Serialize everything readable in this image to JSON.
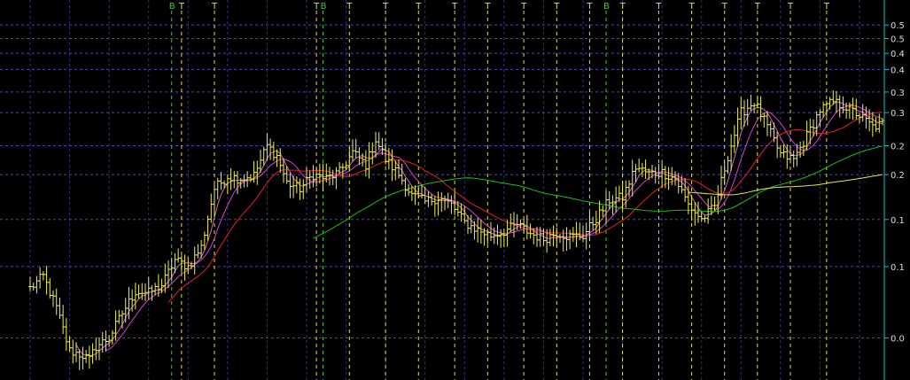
{
  "chart_data": {
    "type": "line",
    "y_scale": "log",
    "ylim": [
      0.065,
      0.56
    ],
    "x_count": 260,
    "y_ticks": [
      "0.5",
      "0.5",
      "0.4",
      "0.4",
      "0.3",
      "0.3",
      "0.2",
      "0.2",
      "0.1",
      "0.1",
      "0.0"
    ],
    "y_tick_values": [
      0.52,
      0.48,
      0.44,
      0.4,
      0.35,
      0.31,
      0.255,
      0.215,
      0.165,
      0.125,
      0.082
    ],
    "grid": true,
    "markers": [
      {
        "label": "B",
        "x": 43,
        "color": "#33cc33"
      },
      {
        "label": "T",
        "x": 46,
        "color": "#e0e040"
      },
      {
        "label": "T",
        "x": 56,
        "color": "#e0e040"
      },
      {
        "label": "T",
        "x": 87,
        "color": "#e0e040"
      },
      {
        "label": "B",
        "x": 89,
        "color": "#33cc33"
      },
      {
        "label": "T",
        "x": 97,
        "color": "#e0e040"
      },
      {
        "label": "T",
        "x": 108,
        "color": "#e0e040"
      },
      {
        "label": "T",
        "x": 118,
        "color": "#e0e040"
      },
      {
        "label": "T",
        "x": 129,
        "color": "#e0e040"
      },
      {
        "label": "T",
        "x": 139,
        "color": "#e0e040"
      },
      {
        "label": "T",
        "x": 150,
        "color": "#e0e040"
      },
      {
        "label": "T",
        "x": 160,
        "color": "#e0e040"
      },
      {
        "label": "T",
        "x": 170,
        "color": "#e0e040"
      },
      {
        "label": "B",
        "x": 175,
        "color": "#33cc33"
      },
      {
        "label": "T",
        "x": 180,
        "color": "#e0e040"
      },
      {
        "label": "T",
        "x": 191,
        "color": "#e0e040"
      },
      {
        "label": "T",
        "x": 201,
        "color": "#e0e040"
      },
      {
        "label": "T",
        "x": 211,
        "color": "#e0e040"
      },
      {
        "label": "T",
        "x": 221,
        "color": "#e0e040"
      },
      {
        "label": "T",
        "x": 231,
        "color": "#e0e040"
      },
      {
        "label": "T",
        "x": 242,
        "color": "#e0e040"
      }
    ],
    "price_anchors": [
      [
        0,
        0.11
      ],
      [
        4,
        0.118
      ],
      [
        8,
        0.098
      ],
      [
        12,
        0.076
      ],
      [
        16,
        0.074
      ],
      [
        18,
        0.072
      ],
      [
        20,
        0.078
      ],
      [
        24,
        0.082
      ],
      [
        28,
        0.095
      ],
      [
        32,
        0.108
      ],
      [
        36,
        0.107
      ],
      [
        40,
        0.112
      ],
      [
        44,
        0.13
      ],
      [
        48,
        0.125
      ],
      [
        52,
        0.14
      ],
      [
        56,
        0.198
      ],
      [
        60,
        0.213
      ],
      [
        64,
        0.21
      ],
      [
        68,
        0.214
      ],
      [
        72,
        0.255
      ],
      [
        75,
        0.24
      ],
      [
        78,
        0.205
      ],
      [
        82,
        0.198
      ],
      [
        86,
        0.215
      ],
      [
        90,
        0.21
      ],
      [
        94,
        0.218
      ],
      [
        98,
        0.245
      ],
      [
        102,
        0.228
      ],
      [
        105,
        0.265
      ],
      [
        108,
        0.235
      ],
      [
        112,
        0.215
      ],
      [
        116,
        0.19
      ],
      [
        120,
        0.183
      ],
      [
        124,
        0.188
      ],
      [
        128,
        0.18
      ],
      [
        132,
        0.162
      ],
      [
        136,
        0.155
      ],
      [
        140,
        0.15
      ],
      [
        144,
        0.154
      ],
      [
        148,
        0.16
      ],
      [
        152,
        0.152
      ],
      [
        156,
        0.147
      ],
      [
        160,
        0.153
      ],
      [
        164,
        0.149
      ],
      [
        168,
        0.15
      ],
      [
        172,
        0.166
      ],
      [
        176,
        0.185
      ],
      [
        180,
        0.188
      ],
      [
        184,
        0.225
      ],
      [
        188,
        0.216
      ],
      [
        192,
        0.218
      ],
      [
        196,
        0.21
      ],
      [
        200,
        0.18
      ],
      [
        204,
        0.165
      ],
      [
        208,
        0.178
      ],
      [
        212,
        0.24
      ],
      [
        216,
        0.31
      ],
      [
        220,
        0.33
      ],
      [
        224,
        0.285
      ],
      [
        228,
        0.242
      ],
      [
        232,
        0.235
      ],
      [
        236,
        0.27
      ],
      [
        240,
        0.315
      ],
      [
        244,
        0.33
      ],
      [
        248,
        0.32
      ],
      [
        252,
        0.305
      ],
      [
        256,
        0.285
      ],
      [
        259,
        0.29
      ]
    ],
    "series": [
      {
        "period": 5,
        "start": 14,
        "color": "#cc66cc"
      },
      {
        "period": 10,
        "start": 23,
        "color": "#d040d0"
      },
      {
        "period": 21,
        "start": 42,
        "color": "#e02020"
      },
      {
        "period": 80,
        "start": 86,
        "color": "#10c010"
      },
      {
        "period": 140,
        "start": 200,
        "color": "#e8e840"
      }
    ],
    "colors": {
      "background": "#000000",
      "grid": "#4a4aa0",
      "price_bars": "#f0f050",
      "axis": "#10c0c0",
      "axis_labels": "#dcdcdc"
    }
  }
}
